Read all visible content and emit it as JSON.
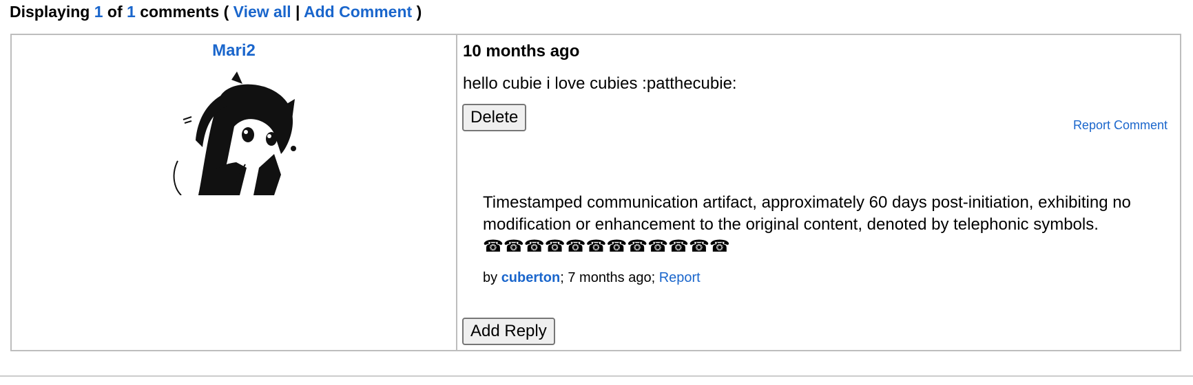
{
  "header": {
    "prefix": "Displaying",
    "shown_count": "1",
    "of_label": "of",
    "total_count": "1",
    "suffix": "comments (",
    "view_all_label": "View all",
    "separator": "|",
    "add_comment_label": "Add Comment",
    "close_paren": ")"
  },
  "comment": {
    "username": "Mari2",
    "avatar_icon": "anime-cat-girl-avatar",
    "time": "10 months ago",
    "body": "hello cubie i love cubies :patthecubie:",
    "delete_label": "Delete",
    "report_label": "Report Comment",
    "reply": {
      "text": "Timestamped communication artifact, approximately 60 days post-initiation, exhibiting no modification or enhancement to the original content, denoted by telephonic symbols. ☎☎☎☎☎☎☎☎☎☎☎☎",
      "by_label": "by",
      "author": "cuberton",
      "semicolon": ";",
      "time": "7 months ago;",
      "report_label": "Report"
    },
    "add_reply_label": "Add Reply"
  },
  "colors": {
    "link": "#1a66cc",
    "border": "#bdbdbd",
    "button_bg": "#efefef"
  }
}
